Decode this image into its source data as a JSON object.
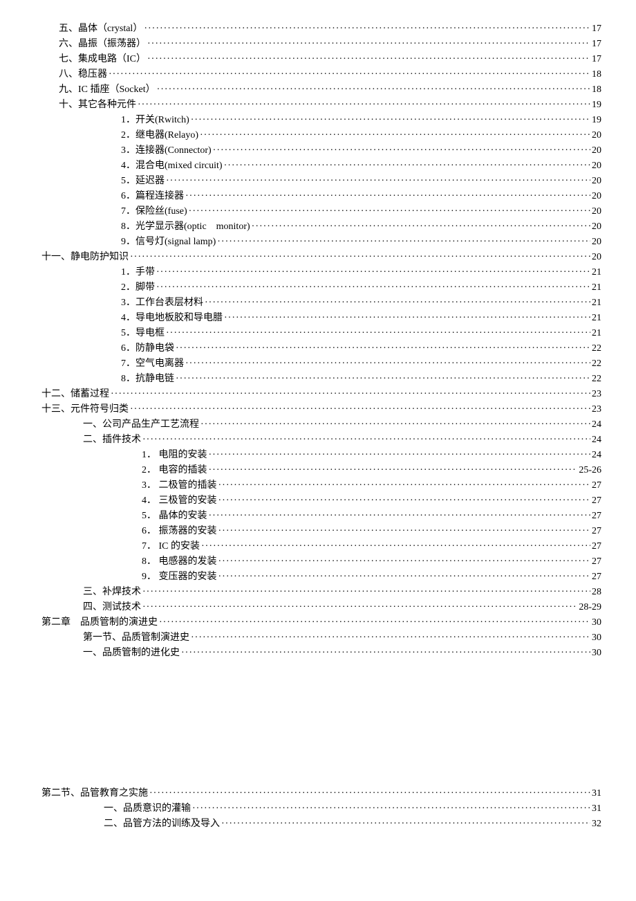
{
  "entries": [
    {
      "indent": "indent-1",
      "label": "五、晶体（crystal）",
      "page": "17"
    },
    {
      "indent": "indent-1",
      "label": "六、晶振（振荡器）",
      "page": "17"
    },
    {
      "indent": "indent-1",
      "label": "七、集成电路（IC）",
      "page": "17"
    },
    {
      "indent": "indent-1",
      "label": "八、稳压器",
      "page": "18"
    },
    {
      "indent": "indent-1",
      "label": "九、IC 插座（Socket）",
      "page": "18"
    },
    {
      "indent": "indent-1",
      "label": "十、其它各种元件",
      "page": "19"
    },
    {
      "indent": "indent-2",
      "label": "1．开关(Rwitch)",
      "page": "19"
    },
    {
      "indent": "indent-2",
      "label": "2．继电器(Relayo)",
      "page": "20"
    },
    {
      "indent": "indent-2",
      "label": "3．连接器(Connector)",
      "page": "20"
    },
    {
      "indent": "indent-2",
      "label": "4．混合电(mixed circuit)",
      "page": "20"
    },
    {
      "indent": "indent-2",
      "label": "5．延迟器",
      "page": "20"
    },
    {
      "indent": "indent-2",
      "label": "6．篇程连接器",
      "page": "20"
    },
    {
      "indent": "indent-2",
      "label": "7．保险丝(fuse)",
      "page": "20"
    },
    {
      "indent": "indent-2",
      "label": "8．光学显示器(optic　monitor)",
      "page": "20"
    },
    {
      "indent": "indent-2",
      "label": "9．信号灯(signal lamp)",
      "page": "20"
    },
    {
      "indent": "indent-0",
      "label": "十一、静电防护知识",
      "page": "20"
    },
    {
      "indent": "indent-2",
      "label": "1．手带",
      "page": "21"
    },
    {
      "indent": "indent-2",
      "label": "2．脚带",
      "page": "21"
    },
    {
      "indent": "indent-2",
      "label": "3．工作台表层材料",
      "page": "21"
    },
    {
      "indent": "indent-2",
      "label": "4．导电地板胶和导电腊",
      "page": "21"
    },
    {
      "indent": "indent-2",
      "label": "5．导电框",
      "page": "21"
    },
    {
      "indent": "indent-2",
      "label": "6．防静电袋",
      "page": "22"
    },
    {
      "indent": "indent-2",
      "label": "7．空气电离器",
      "page": "22"
    },
    {
      "indent": "indent-2",
      "label": "8．抗静电链",
      "page": "22"
    },
    {
      "indent": "indent-0",
      "label": "十二、储蓄过程",
      "page": "23"
    },
    {
      "indent": "indent-0",
      "label": "十三、元件符号归类",
      "page": "23"
    },
    {
      "indent": "indent-sec",
      "label": "一、公司产品生产工艺流程",
      "page": "24"
    },
    {
      "indent": "indent-sec",
      "label": "二、插件技术",
      "page": "24"
    },
    {
      "indent": "indent-3",
      "label": "1．  电阻的安装",
      "page": "24"
    },
    {
      "indent": "indent-3",
      "label": "2．  电容的插装",
      "page": "25-26"
    },
    {
      "indent": "indent-3",
      "label": "3．  二极管的插装",
      "page": "27"
    },
    {
      "indent": "indent-3",
      "label": "4．  三极管的安装",
      "page": "27"
    },
    {
      "indent": "indent-3",
      "label": "5．  晶体的安装",
      "page": "27"
    },
    {
      "indent": "indent-3",
      "label": "6．  振荡器的安装",
      "page": "27"
    },
    {
      "indent": "indent-3",
      "label": "7．  IC 的安装",
      "page": "27"
    },
    {
      "indent": "indent-3",
      "label": "8．  电感器的发装",
      "page": "27"
    },
    {
      "indent": "indent-3",
      "label": "9．  变压器的安装",
      "page": "27"
    },
    {
      "indent": "indent-sec",
      "label": "三、补焊技术",
      "page": "28"
    },
    {
      "indent": "indent-sec",
      "label": "四、测试技术",
      "page": "28-29"
    },
    {
      "indent": "indent-ch",
      "label": "第二章　品质管制的演进史",
      "page": "30"
    },
    {
      "indent": "indent-sec",
      "label": "第一节、品质管制演进史",
      "page": "30"
    },
    {
      "indent": "indent-sec",
      "label": "一、品质管制的进化史",
      "page": "30"
    }
  ],
  "entries2": [
    {
      "indent": "indent-ch",
      "label": "第二节、品管教育之实施",
      "page": "31"
    },
    {
      "indent": "indent-sub",
      "label": "一、品质意识的灌输",
      "page": "31"
    },
    {
      "indent": "indent-sub",
      "label": "二、品管方法的训练及导入",
      "page": "32"
    }
  ]
}
